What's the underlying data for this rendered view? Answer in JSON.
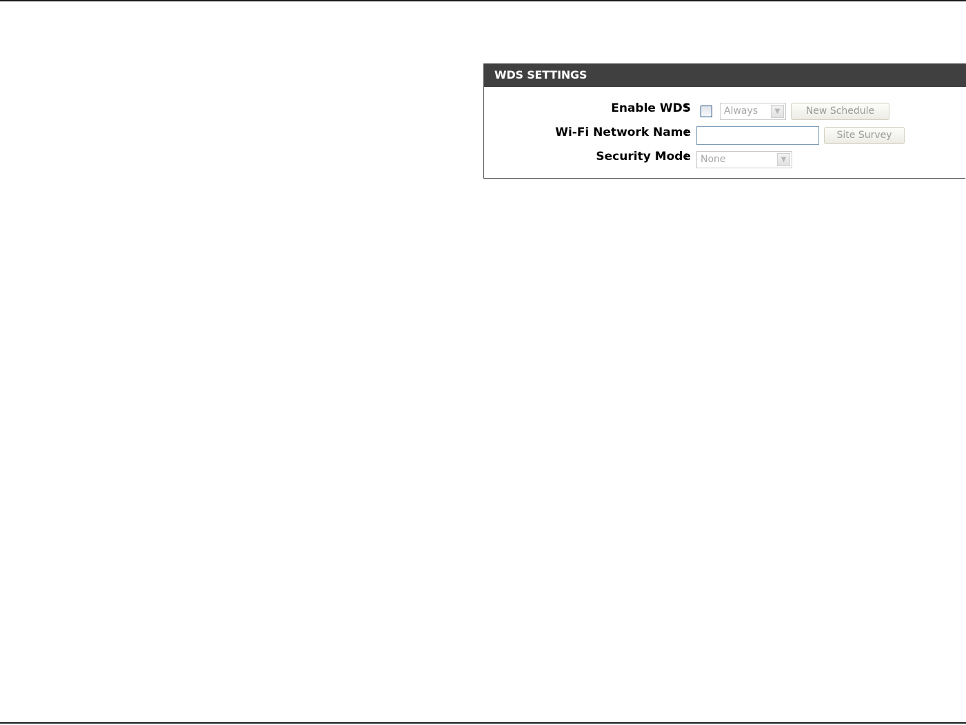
{
  "panel": {
    "title": "WDS SETTINGS"
  },
  "rows": {
    "enable_wds": {
      "label": "Enable WDS",
      "colon": ":",
      "checked": false,
      "schedule_value": "Always",
      "new_schedule_label": "New Schedule"
    },
    "network_name": {
      "label": "Wi-Fi Network Name",
      "colon": ":",
      "value": "",
      "site_survey_label": "Site Survey"
    },
    "security_mode": {
      "label": "Security Mode",
      "colon": ":",
      "value": "None"
    }
  },
  "icons": {
    "dropdown": "chevron-down-icon"
  }
}
